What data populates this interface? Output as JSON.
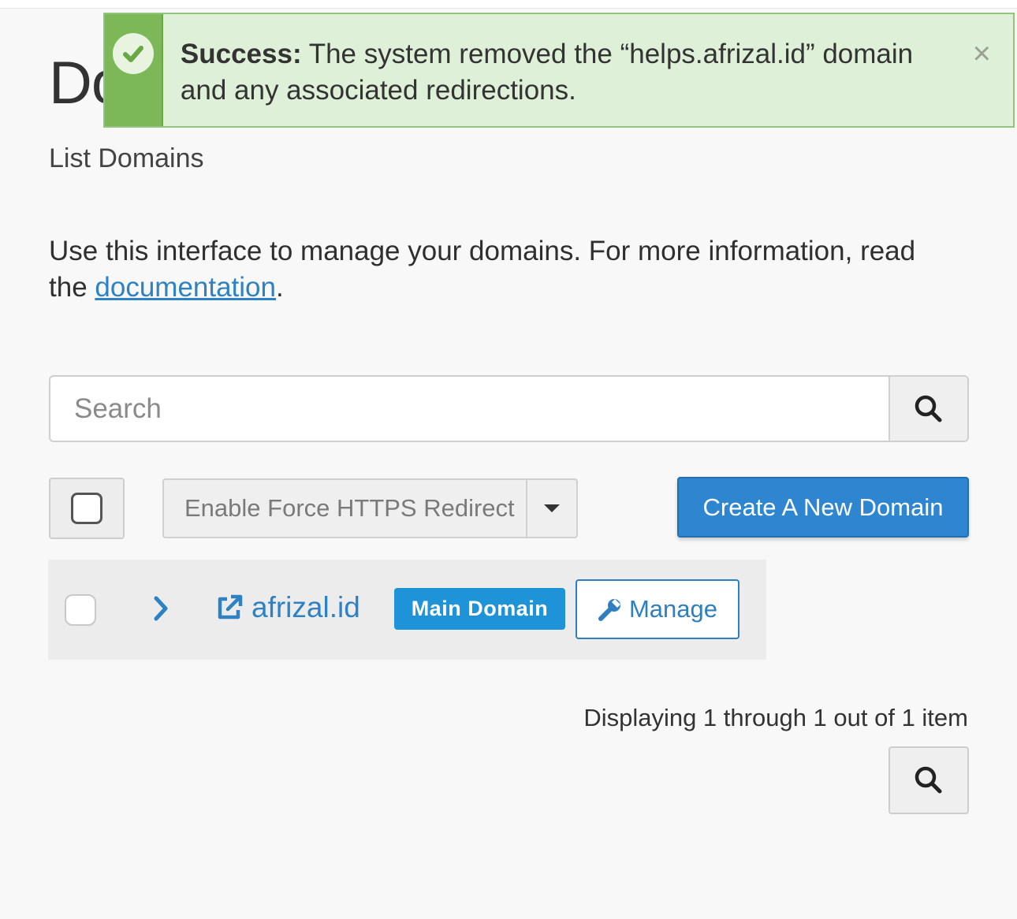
{
  "alert": {
    "type": "success",
    "label": "Success:",
    "message": "The system removed the “helps.afrizal.id” domain and any associated redirections.",
    "close_glyph": "×",
    "icon": "check-circle-icon",
    "accent_color": "#7cb858"
  },
  "page": {
    "title": "Domains",
    "subtitle": "List Domains",
    "intro_text": "Use this interface to manage your domains. For more information, read the ",
    "intro_link": "documentation",
    "intro_end": "."
  },
  "search": {
    "placeholder": "Search",
    "icon": "search-icon"
  },
  "toolbar": {
    "https_label": "Enable Force HTTPS Redirect",
    "create_label": "Create A New Domain",
    "primary_color": "#2f86d0"
  },
  "domains": [
    {
      "name": "afrizal.id",
      "badge": "Main Domain",
      "manage_label": "Manage"
    }
  ],
  "pagination": {
    "info": "Displaying 1 through 1 out of 1 item"
  }
}
